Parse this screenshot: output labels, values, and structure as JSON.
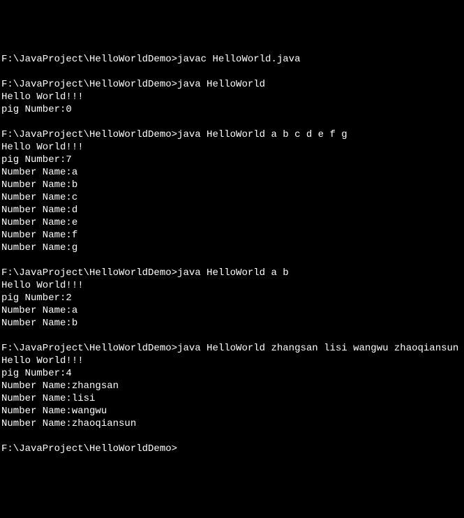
{
  "prompt": "F:\\JavaProject\\HelloWorldDemo>",
  "sessions": [
    {
      "command": "javac HelloWorld.java",
      "output": []
    },
    {
      "command": "java HelloWorld",
      "output": [
        "Hello World!!!",
        "pig Number:0"
      ]
    },
    {
      "command": "java HelloWorld a b c d e f g",
      "output": [
        "Hello World!!!",
        "pig Number:7",
        "Number Name:a",
        "Number Name:b",
        "Number Name:c",
        "Number Name:d",
        "Number Name:e",
        "Number Name:f",
        "Number Name:g"
      ]
    },
    {
      "command": "java HelloWorld a b",
      "output": [
        "Hello World!!!",
        "pig Number:2",
        "Number Name:a",
        "Number Name:b"
      ]
    },
    {
      "command": "java HelloWorld zhangsan lisi wangwu zhaoqiansun",
      "output": [
        "Hello World!!!",
        "pig Number:4",
        "Number Name:zhangsan",
        "Number Name:lisi",
        "Number Name:wangwu",
        "Number Name:zhaoqiansun"
      ]
    }
  ],
  "trailing_prompt": "F:\\JavaProject\\HelloWorldDemo>"
}
